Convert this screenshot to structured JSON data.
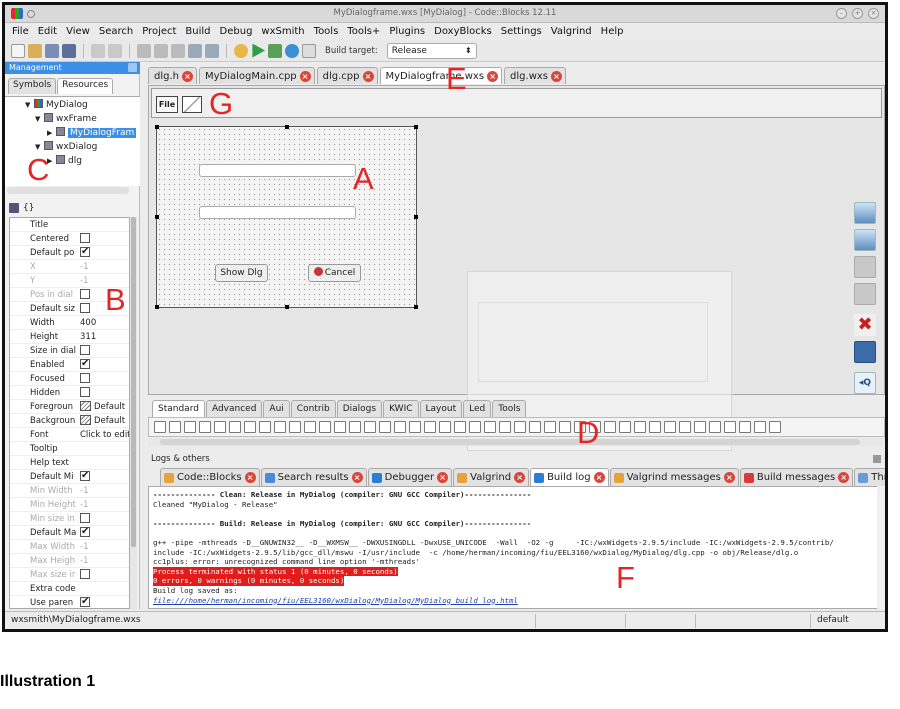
{
  "window": {
    "title": "MyDialogframe.wxs [MyDialog] - Code::Blocks 12.11"
  },
  "menu": [
    "File",
    "Edit",
    "View",
    "Search",
    "Project",
    "Build",
    "Debug",
    "wxSmith",
    "Tools",
    "Tools+",
    "Plugins",
    "DoxyBlocks",
    "Settings",
    "Valgrind",
    "Help"
  ],
  "toolbar": {
    "build_target_label": "Build target:",
    "build_target_value": "Release"
  },
  "management": {
    "title": "Management",
    "tabs": [
      "Symbols",
      "Resources"
    ],
    "tree": [
      "MyDialog",
      "wxFrame",
      "MyDialogFram",
      "wxDialog",
      "dlg"
    ]
  },
  "properties": {
    "toolbar_label": "{}",
    "rows": [
      {
        "name": "Title",
        "value": "",
        "type": "text",
        "disabled": false
      },
      {
        "name": "Centered",
        "value": "",
        "type": "check",
        "checked": false,
        "disabled": false
      },
      {
        "name": "Default po",
        "value": "",
        "type": "check",
        "checked": true,
        "disabled": false
      },
      {
        "name": "X",
        "value": "-1",
        "type": "text",
        "disabled": true
      },
      {
        "name": "Y",
        "value": "-1",
        "type": "text",
        "disabled": true
      },
      {
        "name": "Pos in dial",
        "value": "",
        "type": "check",
        "checked": false,
        "disabled": true
      },
      {
        "name": "Default siz",
        "value": "",
        "type": "check",
        "checked": false,
        "disabled": false
      },
      {
        "name": "Width",
        "value": "400",
        "type": "text",
        "disabled": false
      },
      {
        "name": "Height",
        "value": "311",
        "type": "text",
        "disabled": false
      },
      {
        "name": "Size in dial",
        "value": "",
        "type": "check",
        "checked": false,
        "disabled": false
      },
      {
        "name": "Enabled",
        "value": "",
        "type": "check",
        "checked": true,
        "disabled": false
      },
      {
        "name": "Focused",
        "value": "",
        "type": "check",
        "checked": false,
        "disabled": false
      },
      {
        "name": "Hidden",
        "value": "",
        "type": "check",
        "checked": false,
        "disabled": false
      },
      {
        "name": "Foregroun",
        "value": "Default",
        "type": "color",
        "disabled": false
      },
      {
        "name": "Backgroun",
        "value": "Default",
        "type": "color",
        "disabled": false
      },
      {
        "name": "Font",
        "value": "Click to edit",
        "type": "text",
        "disabled": false
      },
      {
        "name": "Tooltip",
        "value": "",
        "type": "text",
        "disabled": false
      },
      {
        "name": "Help text",
        "value": "",
        "type": "text",
        "disabled": false
      },
      {
        "name": "Default Mi",
        "value": "",
        "type": "check",
        "checked": true,
        "disabled": false
      },
      {
        "name": "Min Width",
        "value": "-1",
        "type": "text",
        "disabled": true
      },
      {
        "name": "Min Height",
        "value": "-1",
        "type": "text",
        "disabled": true
      },
      {
        "name": "Min size in",
        "value": "",
        "type": "check",
        "checked": false,
        "disabled": true
      },
      {
        "name": "Default Ma",
        "value": "",
        "type": "check",
        "checked": true,
        "disabled": false
      },
      {
        "name": "Max Width",
        "value": "-1",
        "type": "text",
        "disabled": true
      },
      {
        "name": "Max Heigh",
        "value": "-1",
        "type": "text",
        "disabled": true
      },
      {
        "name": "Max size ir",
        "value": "",
        "type": "check",
        "checked": false,
        "disabled": true
      },
      {
        "name": "Extra code",
        "value": "",
        "type": "text",
        "disabled": false
      },
      {
        "name": "Use paren",
        "value": "",
        "type": "check",
        "checked": true,
        "disabled": false
      }
    ]
  },
  "editor_tabs": [
    {
      "label": "dlg.h",
      "active": false
    },
    {
      "label": "MyDialogMain.cpp",
      "active": false
    },
    {
      "label": "dlg.cpp",
      "active": false
    },
    {
      "label": "MyDialogframe.wxs",
      "active": true
    },
    {
      "label": "dlg.wxs",
      "active": false
    }
  ],
  "designer": {
    "file_button": "File",
    "show_button": "Show Dlg",
    "cancel_button": "Cancel"
  },
  "palette_tabs": [
    "Standard",
    "Advanced",
    "Aui",
    "Contrib",
    "Dialogs",
    "KWIC",
    "Layout",
    "Led",
    "Tools"
  ],
  "logs": {
    "title": "Logs & others",
    "tabs": [
      {
        "label": "Code::Blocks",
        "active": false,
        "color": "#e8a23a"
      },
      {
        "label": "Search results",
        "active": false,
        "color": "#4a8ad8"
      },
      {
        "label": "Debugger",
        "active": false,
        "color": "#2a7fd4"
      },
      {
        "label": "Valgrind",
        "active": false,
        "color": "#e8a23a"
      },
      {
        "label": "Build log",
        "active": true,
        "color": "#2a7fd4"
      },
      {
        "label": "Valgrind messages",
        "active": false,
        "color": "#e8a23a"
      },
      {
        "label": "Build messages",
        "active": false,
        "color": "#d93a3a"
      },
      {
        "label": "Thread search",
        "active": false,
        "color": "#6a9ad8"
      }
    ],
    "lines": [
      {
        "text": "-------------- Clean: Release in MyDialog (compiler: GNU GCC Compiler)---------------",
        "kind": "bold"
      },
      {
        "text": "Cleaned \"MyDialog - Release\"",
        "kind": "normal"
      },
      {
        "text": "",
        "kind": "normal"
      },
      {
        "text": "-------------- Build: Release in MyDialog (compiler: GNU GCC Compiler)---------------",
        "kind": "bold"
      },
      {
        "text": "",
        "kind": "normal"
      },
      {
        "text": "g++ -pipe -mthreads -D__GNUWIN32__ -D__WXMSW__ -DWXUSINGDLL -DwxUSE_UNICODE  -Wall  -O2 -g     -IC:/wxWidgets-2.9.5/include -IC:/wxWidgets-2.9.5/contrib/",
        "kind": "normal"
      },
      {
        "text": "include -IC:/wxWidgets-2.9.5/lib/gcc_dll/mswu -I/usr/include  -c /home/herman/incoming/fiu/EEL3160/wxDialog/MyDialog/dlg.cpp -o obj/Release/dlg.o",
        "kind": "normal"
      },
      {
        "text": "cc1plus: error: unrecognized command line option '-mthreads'",
        "kind": "normal"
      },
      {
        "text": "Process terminated with status 1 (0 minutes, 0 seconds)",
        "kind": "err"
      },
      {
        "text": "0 errors, 0 warnings (0 minutes, 0 seconds)",
        "kind": "err"
      },
      {
        "text": "Build log saved as:",
        "kind": "normal"
      },
      {
        "text": "file:///home/herman/incoming/fiu/EEL3160/wxDialog/MyDialog/MyDialog_build_log.html",
        "kind": "link"
      }
    ]
  },
  "status": {
    "left": "wxsmith\\MyDialogframe.wxs",
    "right": "default"
  },
  "annotations": {
    "A": "A",
    "B": "B",
    "C": "C",
    "D": "D",
    "E": "E",
    "F": "F",
    "G": "G"
  },
  "caption": "Illustration 1"
}
